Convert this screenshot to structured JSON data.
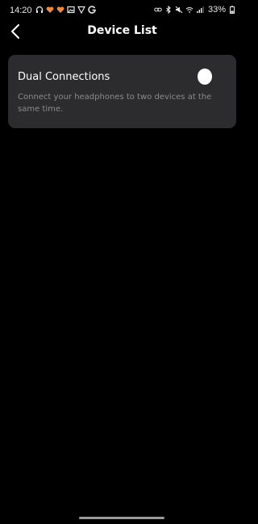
{
  "status_bar": {
    "time": "14:20",
    "battery": "33%",
    "left_icons": [
      "headphones-icon",
      "heart-icon",
      "heart-icon",
      "gallery-icon",
      "shield-icon",
      "google-icon"
    ],
    "right_icons": [
      "link-icon",
      "bluetooth-icon",
      "mute-icon",
      "wifi-icon",
      "signal-icon",
      "battery-icon"
    ]
  },
  "header": {
    "title": "Device List",
    "back_icon": "chevron-left-icon"
  },
  "dual_connections": {
    "title": "Dual Connections",
    "description": "Connect your headphones to two devices at the same time.",
    "toggle_state": "off"
  },
  "colors": {
    "background": "#000000",
    "card": "#2c2c2e",
    "secondary_text": "#8a8a8e",
    "icon_accent": "#f08a3c"
  }
}
